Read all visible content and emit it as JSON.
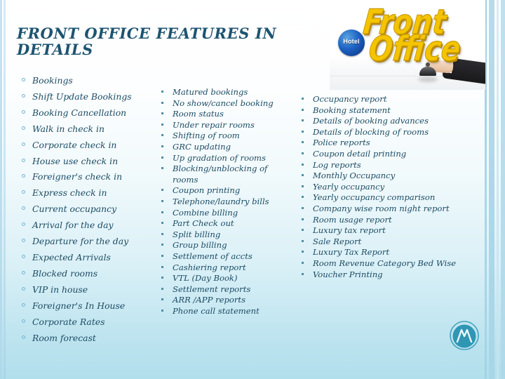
{
  "slide": {
    "title": "FRONT OFFICE FEATURES IN DETAILS",
    "background_top_color": "#ffffff",
    "background_bottom_color": "#b2dfec",
    "title_color": "#1d5470",
    "text_color": "#1b4b63"
  },
  "hero_image": {
    "name": "front-office-hotel-bell-photo",
    "badge_label": "Hotel",
    "word_line1": "Front",
    "word_line2": "Office",
    "word_color": "#f5c400"
  },
  "columns": {
    "left": {
      "bullet_style": "hollow-circle",
      "items": [
        "Bookings",
        "Shift Update Bookings",
        "Booking Cancellation",
        "Walk in check in",
        "Corporate check in",
        "House use check in",
        "Foreigner's check in",
        "Express check in",
        "Current occupancy",
        "Arrival for the day",
        "Departure for the day",
        "Expected Arrivals",
        "Blocked rooms",
        "VIP in house",
        "Foreigner's In House",
        "Corporate Rates",
        "Room forecast"
      ]
    },
    "middle": {
      "bullet_style": "small-square",
      "items": [
        "Matured bookings",
        "No show/cancel booking",
        "Room status",
        "Under repair rooms",
        "Shifting of room",
        "GRC updating",
        "Up gradation of rooms",
        "Blocking/unblocking of rooms",
        "Coupon printing",
        "Telephone/laundry bills",
        "Combine billing",
        "Part Check out",
        "Split billing",
        "Group billing",
        "Settlement of accts",
        "Cashiering report",
        "VTL (Day Book)",
        "Settlement reports",
        "ARR /APP reports",
        "Phone call statement"
      ]
    },
    "right": {
      "bullet_style": "small-square",
      "items": [
        "Occupancy report",
        "Booking statement",
        "Details of booking advances",
        "Details of blocking of rooms",
        "Police reports",
        "Coupon detail printing",
        "Log reports",
        "Monthly Occupancy",
        "Yearly occupancy",
        "Yearly occupancy comparison",
        "Company wise room night report",
        "Room usage report",
        "Luxury tax report",
        "Sale Report",
        "Luxury Tax Report",
        "Room Revenue Category Bed Wise",
        "Voucher Printing"
      ]
    }
  },
  "logo": {
    "name": "monogram-m-logo",
    "color": "#2f96b4"
  }
}
